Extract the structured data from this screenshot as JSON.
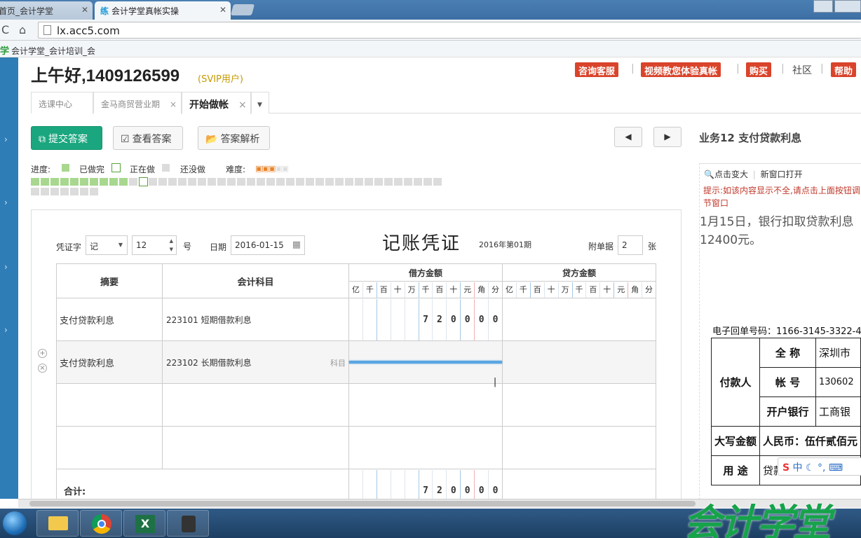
{
  "browser": {
    "tabs": [
      {
        "label": "首页_会计学堂",
        "active": false
      },
      {
        "label": "会计学堂真帐实操",
        "prefix": "练",
        "active": true
      }
    ],
    "url": "lx.acc5.com",
    "bookmark": "会计学堂_会计培训_会",
    "bookmark_icon": "学"
  },
  "header": {
    "greeting": "上午好,1409126599",
    "user_type": "(SVIP用户)",
    "links": {
      "consult": "咨询客服",
      "trial": "视频教您体验真帐",
      "buy": "购买",
      "community": "社区",
      "help": "帮助"
    }
  },
  "page_tabs": [
    {
      "label": "选课中心"
    },
    {
      "label": "金马商贸营业期"
    },
    {
      "label": "开始做帐"
    }
  ],
  "toolbar": {
    "submit": "提交答案",
    "view": "查看答案",
    "analysis": "答案解析"
  },
  "progress": {
    "label": "进度:",
    "done": "已做完",
    "doing": "正在做",
    "todo": "还没做",
    "difficulty_label": "难度:",
    "difficulty": 3,
    "difficulty_max": 5,
    "row1_total": 42,
    "row1_done": 10,
    "row1_current": 11,
    "row2_total": 7
  },
  "voucher": {
    "word_label": "凭证字",
    "word_value": "记",
    "number_value": "12",
    "number_suffix": "号",
    "date_label": "日期",
    "date_value": "2016-01-15",
    "title": "记账凭证",
    "period": "2016年第01期",
    "attach_label": "附单据",
    "attach_value": "2",
    "attach_suffix": "张",
    "col_summary": "摘要",
    "col_account": "会计科目",
    "col_debit": "借方金额",
    "col_credit": "贷方金额",
    "digit_units": [
      "亿",
      "千",
      "百",
      "十",
      "万",
      "千",
      "百",
      "十",
      "元",
      "角",
      "分"
    ],
    "rows": [
      {
        "summary": "支付贷款利息",
        "account": "223101 短期借款利息",
        "debit": [
          "",
          "",
          "",
          "",
          "",
          "7",
          "2",
          "0",
          "0",
          "0",
          "0"
        ],
        "hint": ""
      },
      {
        "summary": "支付贷款利息",
        "account": "223102 长期借款利息",
        "debit": [
          "",
          "",
          "",
          "",
          "",
          "",
          "",
          "",
          "",
          "",
          ""
        ],
        "hint": "科目"
      },
      {
        "summary": "",
        "account": "",
        "debit": [
          "",
          "",
          "",
          "",
          "",
          "",
          "",
          "",
          "",
          "",
          ""
        ],
        "hint": ""
      },
      {
        "summary": "",
        "account": "",
        "debit": [
          "",
          "",
          "",
          "",
          "",
          "",
          "",
          "",
          "",
          "",
          ""
        ],
        "hint": ""
      }
    ],
    "total_label": "合计:",
    "total_debit": [
      "",
      "",
      "",
      "",
      "",
      "7",
      "2",
      "0",
      "0",
      "0",
      "0"
    ]
  },
  "right_panel": {
    "biz_title": "业务12 支付贷款利息",
    "zoom": "点击变大",
    "new_window": "新窗口打开",
    "tip": "提示:如该内容显示不全,请点击上面按钮调节窗口",
    "desc": "1月15日，银行扣取贷款利息12400元。",
    "receipt_no": "电子回单号码：1166-3145-3322-4",
    "receipt": {
      "payer": "付款人",
      "full_name_label": "全 称",
      "full_name": "深圳市",
      "account_label": "帐 号",
      "account": "130602",
      "bank_label": "开户银行",
      "bank": "工商银",
      "amount_label": "大写金额",
      "amount": "人民币：伍仟贰佰元",
      "purpose_label": "用 途",
      "purpose": "贷款利息"
    }
  },
  "ime": "中",
  "watermark": "会计学堂"
}
